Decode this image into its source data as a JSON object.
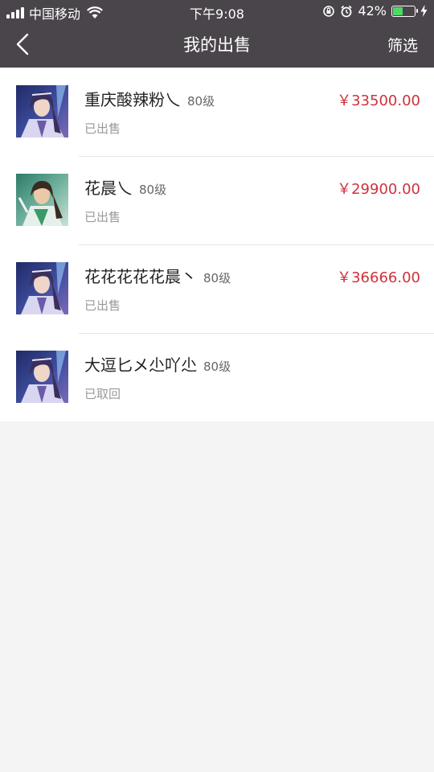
{
  "status_bar": {
    "carrier": "中国移动",
    "time": "下午9:08",
    "battery_percent": "42%",
    "battery_level": 0.42
  },
  "navbar": {
    "title": "我的出售",
    "filter_label": "筛选"
  },
  "items": [
    {
      "name": "重庆酸辣粉乀",
      "level": "80级",
      "status": "已出售",
      "price": "￥33500.00",
      "avatar": "purple-hair-warrior-avatar"
    },
    {
      "name": "花晨乀",
      "level": "80级",
      "status": "已出售",
      "price": "￥29900.00",
      "avatar": "green-robe-warrior-avatar"
    },
    {
      "name": "花花花花花晨丶",
      "level": "80级",
      "status": "已出售",
      "price": "￥36666.00",
      "avatar": "purple-hair-warrior-avatar"
    },
    {
      "name": "大逗匕メ尐吖尐",
      "level": "80级",
      "status": "已取回",
      "price": "",
      "avatar": "purple-hair-warrior-avatar"
    }
  ]
}
